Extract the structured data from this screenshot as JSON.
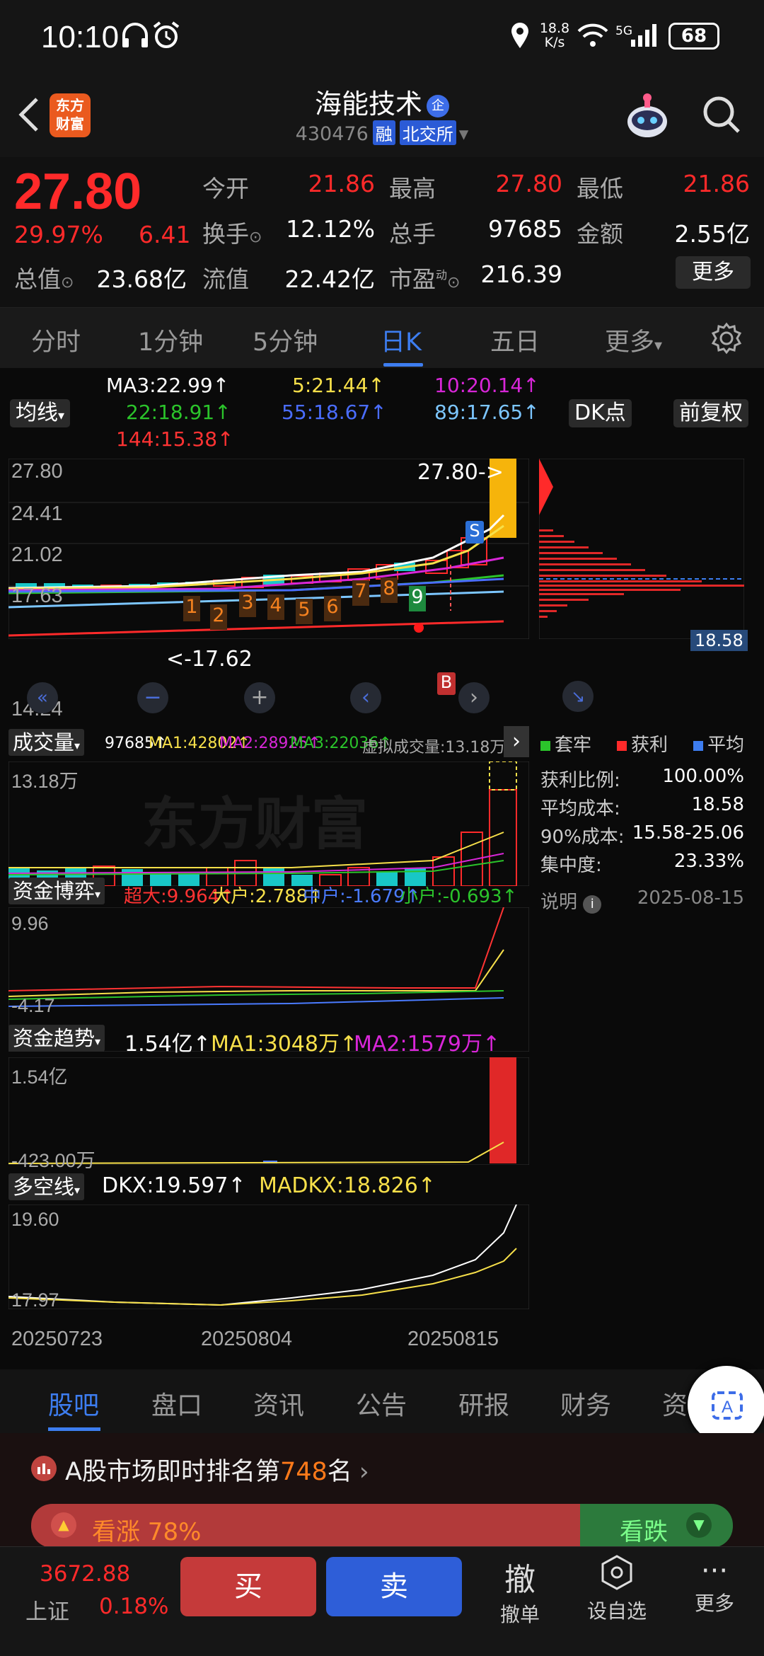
{
  "status_bar": {
    "time": "10:10",
    "net_speed_top": "18.8",
    "net_speed_bottom": "K/s",
    "signal": "5G",
    "battery": "68"
  },
  "header": {
    "stock_name": "海能技术",
    "badge": "企",
    "code": "430476",
    "tag_margin": "融",
    "tag_market": "北交所",
    "logo_line1": "东方",
    "logo_line2": "财富"
  },
  "quote": {
    "price": "27.80",
    "change_pct": "29.97%",
    "change": "6.41",
    "open_label": "今开",
    "open": "21.86",
    "high_label": "最高",
    "high": "27.80",
    "low_label": "最低",
    "low": "21.86",
    "turnover_label": "换手",
    "turnover": "12.12%",
    "volume_label": "总手",
    "volume": "97685",
    "amount_label": "金额",
    "amount": "2.55亿",
    "mktcap_label": "总值",
    "mktcap": "23.68亿",
    "float_label": "流值",
    "float_cap": "22.42亿",
    "pe_label": "市盈",
    "pe_sup": "动",
    "pe": "216.39",
    "more": "更多"
  },
  "period_tabs": [
    "分时",
    "1分钟",
    "5分钟",
    "日K",
    "五日",
    "更多"
  ],
  "period_active": 3,
  "ma": {
    "selector": "均线",
    "ma3": "MA3:22.99↑",
    "ma5": "5:21.44↑",
    "ma10": "10:20.14↑",
    "ma22": "22:18.91↑",
    "ma55": "55:18.67↑",
    "ma89": "89:17.65↑",
    "ma144": "144:15.38↑",
    "dk_btn": "DK点",
    "adj_btn": "前复权"
  },
  "kline": {
    "y_labels": [
      "27.80",
      "24.41",
      "21.02",
      "17.63",
      "14.24"
    ],
    "last_price_tag": "27.80->",
    "min_tag": "<-17.62",
    "counts": [
      "1",
      "2",
      "3",
      "4",
      "5",
      "6",
      "7",
      "8",
      "9"
    ],
    "sell_mark": "S",
    "buy_mark": "B",
    "watermark": "东方财富"
  },
  "chip": {
    "price_tag": "18.58",
    "legend": [
      "套牢",
      "获利",
      "平均"
    ],
    "rows": [
      {
        "label": "获利比例:",
        "value": "100.00%"
      },
      {
        "label": "平均成本:",
        "value": "18.58"
      },
      {
        "label": "90%成本:",
        "value": "15.58-25.06"
      },
      {
        "label": "集中度:",
        "value": "23.33%"
      }
    ],
    "note_label": "说明",
    "date": "2025-08-15"
  },
  "volume": {
    "selector": "成交量",
    "v": "97685↑",
    "ma1": "MA1:42802↑",
    "ma2": "MA2:28925↑",
    "ma3": "MA3:22036↑",
    "virtual": "虚拟成交量:13.18万",
    "y_top": "13.18万"
  },
  "capital_game": {
    "selector": "资金博弈",
    "super": "超大:9.964↑",
    "big": "大户:2.788↑",
    "mid": "中户:-1.679↑",
    "small": "小户:-0.693↑",
    "y_top": "9.96",
    "y_bottom": "-4.17"
  },
  "capital_trend": {
    "selector": "资金趋势",
    "v": "1.54亿↑",
    "ma1": "MA1:3048万↑",
    "ma2": "MA2:1579万↑",
    "y_top": "1.54亿",
    "y_bottom": "-423.00万"
  },
  "dkx": {
    "selector": "多空线",
    "dkx": "DKX:19.597↑",
    "madkx": "MADKX:18.826↑",
    "y_top": "19.60",
    "y_bottom": "17.97"
  },
  "x_axis": [
    "20250723",
    "20250804",
    "20250815"
  ],
  "news_tabs": [
    "股吧",
    "盘口",
    "资讯",
    "公告",
    "研报",
    "财务",
    "资"
  ],
  "news_active": 0,
  "rank": {
    "prefix": "A股市场即时排名第",
    "number": "748",
    "suffix": "名",
    "up_label": "看涨 78%",
    "down_label": "看跌"
  },
  "bottom": {
    "index_value": "3672.88",
    "index_name": "上证",
    "index_pct": "0.18%",
    "buy": "买",
    "sell": "卖",
    "cancel_glyph": "撤",
    "cancel": "撤单",
    "watch": "设自选",
    "more": "更多"
  },
  "colors": {
    "up": "#ff2a2a",
    "down": "#18c7c7",
    "accent": "#3d7df0",
    "yellow": "#f7e04a",
    "magenta": "#d826d8",
    "green": "#2bc42b",
    "blue": "#4a7bff",
    "orange": "#f6b40b"
  }
}
